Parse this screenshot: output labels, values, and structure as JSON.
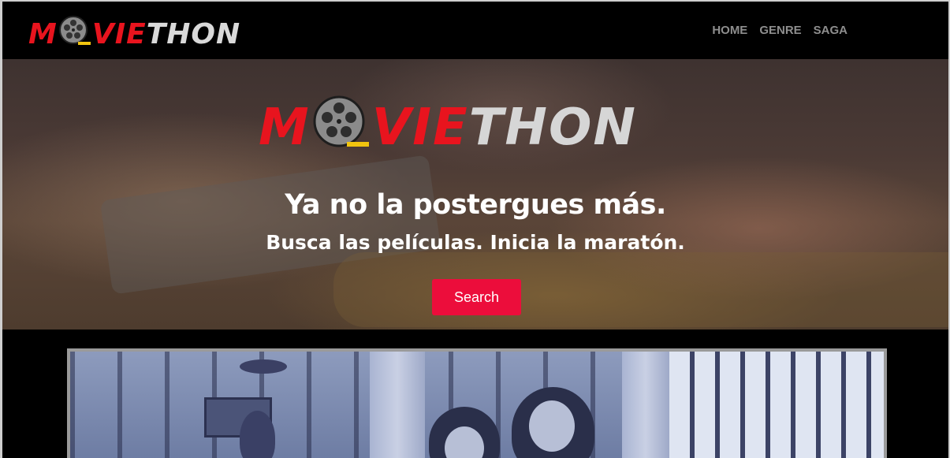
{
  "navbar": {
    "brand": {
      "part1": "M",
      "part2": "VIE",
      "part3": "THON"
    },
    "links": [
      "HOME",
      "GENRE",
      "SAGA"
    ]
  },
  "hero": {
    "logo": {
      "part1": "M",
      "part2": "VIE",
      "part3": "THON"
    },
    "headline": "Ya no la postergues más.",
    "subline": "Busca las películas. Inicia la maratón.",
    "search_label": "Search"
  },
  "colors": {
    "brand_red": "#e8141e",
    "button": "#ec0d3b",
    "nav_text": "#8e8e8e"
  },
  "icons": {
    "reel": "film-reel-icon"
  }
}
